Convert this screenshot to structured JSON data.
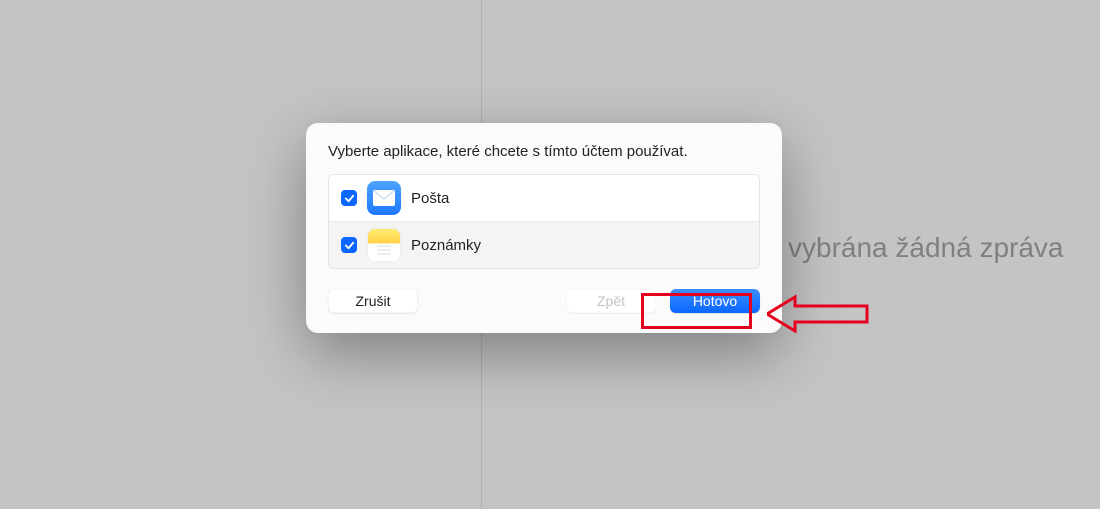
{
  "background": {
    "text_partial": "vybrána žádná zpráva"
  },
  "dialog": {
    "title": "Vyberte aplikace, které chcete s tímto účtem používat.",
    "apps": [
      {
        "label": "Pošta",
        "checked": true,
        "icon": "mail"
      },
      {
        "label": "Poznámky",
        "checked": true,
        "icon": "notes"
      }
    ],
    "buttons": {
      "cancel": "Zrušit",
      "back": "Zpět",
      "done": "Hotovo"
    }
  },
  "colors": {
    "accent": "#0a66ff",
    "annotation": "#e6001f"
  }
}
